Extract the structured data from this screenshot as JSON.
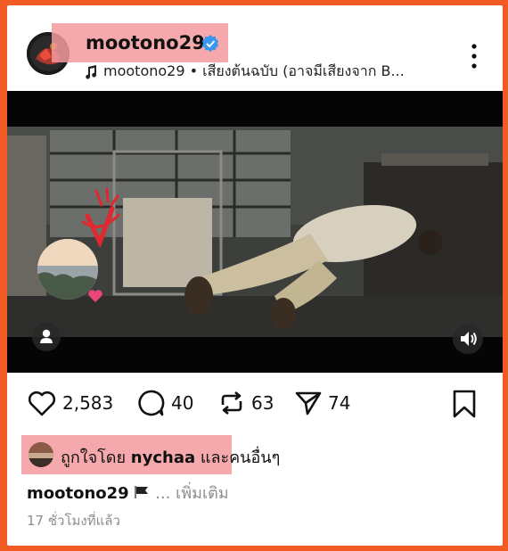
{
  "post": {
    "username": "mootono29",
    "audio_label": "mootono29 • เสียงต้นฉบับ (อาจมีเสียงจาก B...",
    "verified": true
  },
  "actions": {
    "likes": "2,583",
    "comments": "40",
    "reposts": "63",
    "shares": "74"
  },
  "liked_by": {
    "prefix": "ถูกใจโดย",
    "user": "nychaa",
    "suffix": "และคนอื่นๆ"
  },
  "caption": {
    "user": "mootono29",
    "more": "... เพิ่มเติม"
  },
  "timestamp": "17 ชั่วโมงที่แล้ว",
  "colors": {
    "frame": "#f15a22",
    "highlight": "#f59a9e",
    "verified": "#3897f0",
    "heart": "#e8457a"
  },
  "icons": [
    "verified-badge-icon",
    "music-note-icon",
    "more-options-icon",
    "person-tag-icon",
    "sound-icon",
    "heart-icon",
    "comment-icon",
    "repost-icon",
    "share-icon",
    "bookmark-icon"
  ]
}
